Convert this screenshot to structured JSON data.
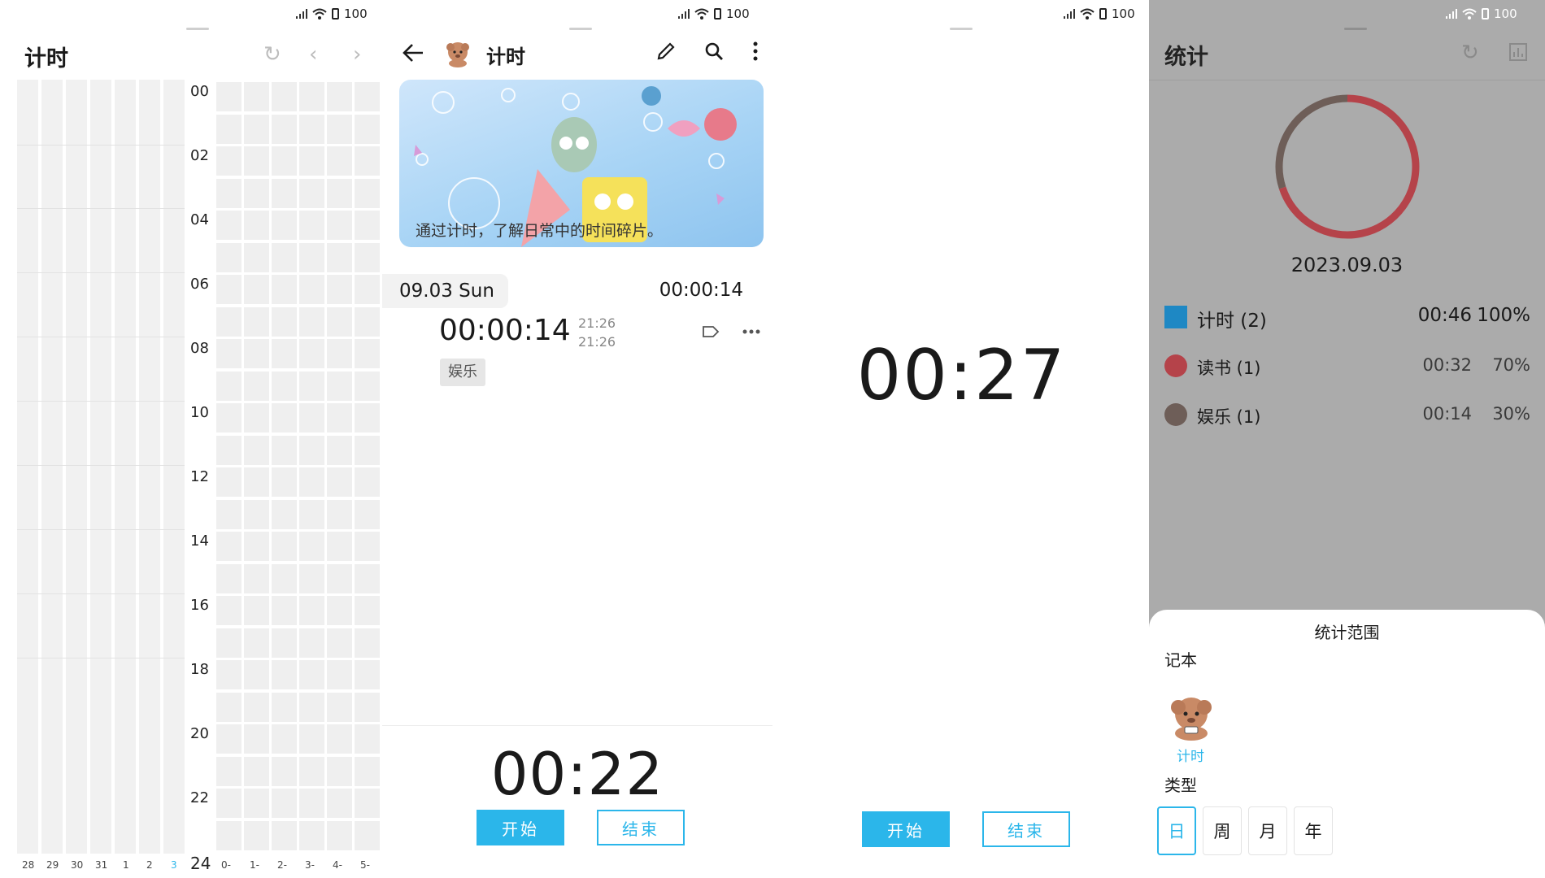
{
  "status_bar": {
    "battery": "100"
  },
  "panel1": {
    "title": "计时",
    "hour_labels": [
      "00",
      "02",
      "04",
      "06",
      "08",
      "10",
      "12",
      "14",
      "16",
      "18",
      "20",
      "22",
      "24"
    ],
    "day_labels": [
      "28",
      "29",
      "30",
      "31",
      "1",
      "2",
      "3"
    ],
    "week_labels": [
      "0-",
      "1-",
      "2-",
      "3-",
      "4-",
      "5-"
    ],
    "highlight_color": "#2bb6ea"
  },
  "panel2": {
    "title": "计时",
    "banner_caption": "通过计时，了解日常中的时间碎片。",
    "day_label": "09.03 Sun",
    "day_total": "00:00:14",
    "entry_duration": "00:00:14",
    "entry_start": "21:26",
    "entry_end": "21:26",
    "entry_tag": "娱乐",
    "timer": "00:22",
    "start_label": "开始",
    "end_label": "结束"
  },
  "panel3": {
    "timer": "00:27",
    "start_label": "开始",
    "end_label": "结束"
  },
  "panel4": {
    "title": "统计",
    "date": "2023.09.03",
    "chart_data": {
      "type": "pie",
      "categories": [
        "读书",
        "娱乐"
      ],
      "values": [
        70,
        30
      ],
      "colors": [
        "#b5434a",
        "#6e5e58"
      ]
    },
    "rows": [
      {
        "name": "计时 (2)",
        "time": "00:46",
        "pct": "100%",
        "color": "#1e88c4",
        "shape": "square"
      },
      {
        "name": "读书 (1)",
        "time": "00:32",
        "pct": "70%",
        "color": "#b5434a",
        "shape": "circle"
      },
      {
        "name": "娱乐 (1)",
        "time": "00:14",
        "pct": "30%",
        "color": "#6e5e58",
        "shape": "circle"
      }
    ],
    "sheet": {
      "title": "统计范围",
      "notebook_label": "记本",
      "notebook_name": "计时",
      "type_label": "类型",
      "types": [
        "日",
        "周",
        "月",
        "年"
      ],
      "selected_type": "日"
    }
  }
}
